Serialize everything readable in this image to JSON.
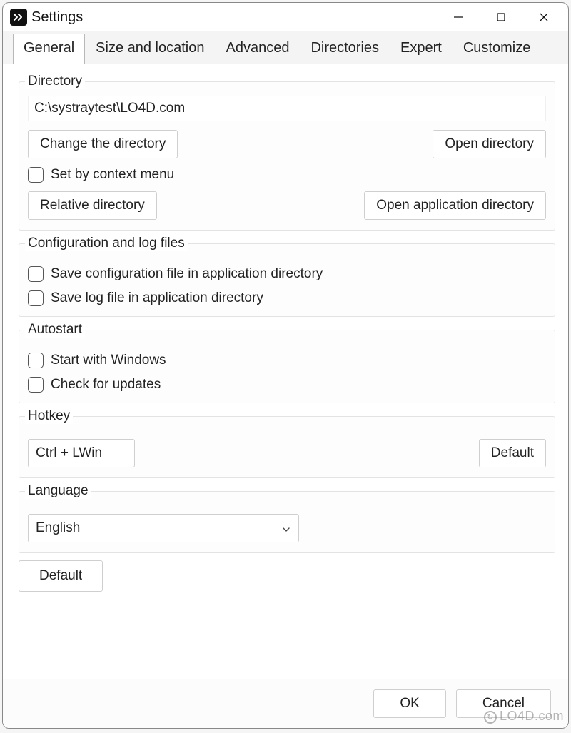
{
  "window": {
    "title": "Settings"
  },
  "tabs": [
    {
      "label": "General",
      "active": true
    },
    {
      "label": "Size and location",
      "active": false
    },
    {
      "label": "Advanced",
      "active": false
    },
    {
      "label": "Directories",
      "active": false
    },
    {
      "label": "Expert",
      "active": false
    },
    {
      "label": "Customize",
      "active": false
    }
  ],
  "directory": {
    "title": "Directory",
    "path": "C:\\systraytest\\LO4D.com",
    "change_btn": "Change the directory",
    "open_btn": "Open directory",
    "context_menu_check": "Set by context menu",
    "relative_btn": "Relative directory",
    "open_app_btn": "Open application directory"
  },
  "config": {
    "title": "Configuration and log files",
    "save_config_check": "Save configuration file in application directory",
    "save_log_check": "Save log file in application directory"
  },
  "autostart": {
    "title": "Autostart",
    "start_win_check": "Start with Windows",
    "updates_check": "Check for updates"
  },
  "hotkey": {
    "title": "Hotkey",
    "value": "Ctrl + LWin",
    "default_btn": "Default"
  },
  "language": {
    "title": "Language",
    "value": "English",
    "default_btn": "Default"
  },
  "footer": {
    "ok": "OK",
    "cancel": "Cancel"
  },
  "watermark": "LO4D.com"
}
